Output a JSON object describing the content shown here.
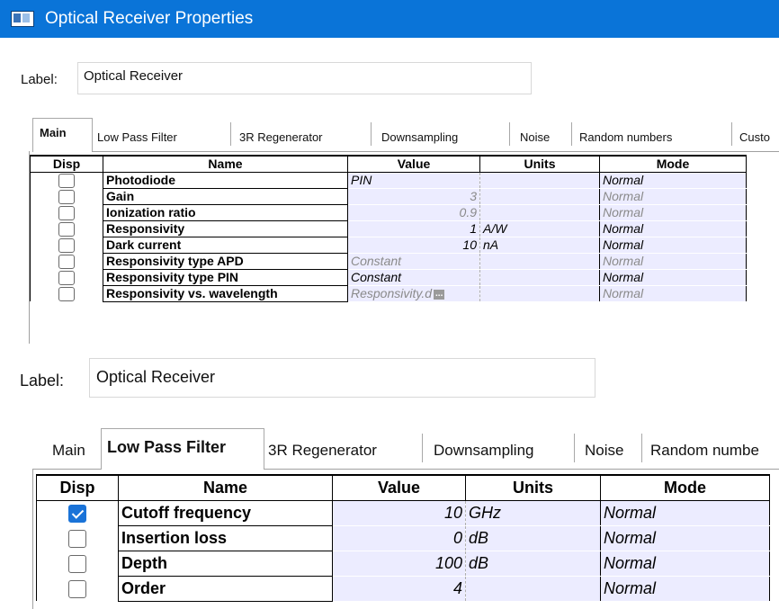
{
  "window": {
    "title": "Optical Receiver Properties"
  },
  "panel1": {
    "label_caption": "Label:",
    "label_value": "Optical Receiver",
    "tabs": [
      {
        "label": "Main",
        "active": true
      },
      {
        "label": "Low Pass Filter",
        "active": false
      },
      {
        "label": "3R Regenerator",
        "active": false
      },
      {
        "label": "Downsampling",
        "active": false
      },
      {
        "label": "Noise",
        "active": false
      },
      {
        "label": "Random numbers",
        "active": false
      },
      {
        "label": "Custo",
        "active": false
      }
    ],
    "columns": [
      "Disp",
      "Name",
      "Value",
      "Units",
      "Mode"
    ],
    "rows": [
      {
        "disp": false,
        "name": "Photodiode",
        "value": "PIN",
        "units": "",
        "mode": "Normal",
        "value_align": "left",
        "dim": false
      },
      {
        "disp": false,
        "name": "Gain",
        "value": "3",
        "units": "",
        "mode": "Normal",
        "value_align": "right",
        "dim": true
      },
      {
        "disp": false,
        "name": "Ionization ratio",
        "value": "0.9",
        "units": "",
        "mode": "Normal",
        "value_align": "right",
        "dim": true
      },
      {
        "disp": false,
        "name": "Responsivity",
        "value": "1",
        "units": "A/W",
        "mode": "Normal",
        "value_align": "right",
        "dim": false
      },
      {
        "disp": false,
        "name": "Dark current",
        "value": "10",
        "units": "nA",
        "mode": "Normal",
        "value_align": "right",
        "dim": false
      },
      {
        "disp": false,
        "name": "Responsivity type APD",
        "value": "Constant",
        "units": "",
        "mode": "Normal",
        "value_align": "left",
        "dim": true
      },
      {
        "disp": false,
        "name": "Responsivity type PIN",
        "value": "Constant",
        "units": "",
        "mode": "Normal",
        "value_align": "left",
        "dim": false
      },
      {
        "disp": false,
        "name": "Responsivity vs. wavelength",
        "value": "Responsivity.d",
        "units": "",
        "mode": "Normal",
        "value_align": "left",
        "dim": true,
        "browse_button": "..."
      }
    ]
  },
  "panel2": {
    "label_caption": "Label:",
    "label_value": "Optical Receiver",
    "tabs": [
      {
        "label": "Main",
        "active": false
      },
      {
        "label": "Low Pass Filter",
        "active": true
      },
      {
        "label": "3R Regenerator",
        "active": false
      },
      {
        "label": "Downsampling",
        "active": false
      },
      {
        "label": "Noise",
        "active": false
      },
      {
        "label": "Random numbe",
        "active": false
      }
    ],
    "columns": [
      "Disp",
      "Name",
      "Value",
      "Units",
      "Mode"
    ],
    "rows": [
      {
        "disp": true,
        "name": "Cutoff frequency",
        "value": "10",
        "units": "GHz",
        "mode": "Normal"
      },
      {
        "disp": false,
        "name": "Insertion loss",
        "value": "0",
        "units": "dB",
        "mode": "Normal"
      },
      {
        "disp": false,
        "name": "Depth",
        "value": "100",
        "units": "dB",
        "mode": "Normal"
      },
      {
        "disp": false,
        "name": "Order",
        "value": "4",
        "units": "",
        "mode": "Normal"
      }
    ]
  }
}
